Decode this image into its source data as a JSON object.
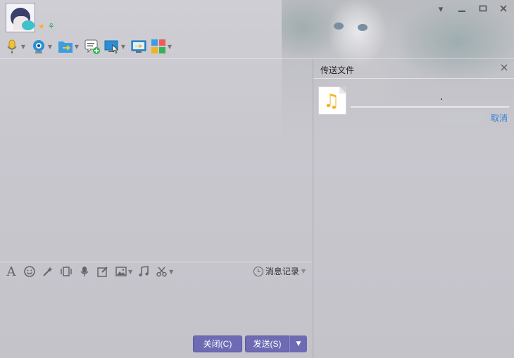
{
  "window": {
    "controls": {
      "dropdown_icon": "chevron-down-icon",
      "minimize_icon": "minimize-icon",
      "maximize_icon": "maximize-icon",
      "close_icon": "close-icon"
    }
  },
  "header": {
    "avatar_icon": "avatar-image",
    "status_icons": [
      "star-icon",
      "leaf-icon"
    ]
  },
  "toolbar": {
    "items": [
      {
        "icon": "microphone-icon",
        "has_dropdown": true
      },
      {
        "icon": "webcam-icon",
        "has_dropdown": true
      },
      {
        "icon": "send-file-folder-icon",
        "has_dropdown": true
      },
      {
        "icon": "new-chat-icon",
        "has_dropdown": false
      },
      {
        "icon": "remote-desktop-icon",
        "has_dropdown": true
      },
      {
        "icon": "screen-share-icon",
        "has_dropdown": false
      },
      {
        "icon": "apps-grid-icon",
        "has_dropdown": true
      }
    ]
  },
  "format_bar": {
    "icons": [
      "font-icon",
      "emoji-icon",
      "magic-icon",
      "shake-icon",
      "voice-icon",
      "edit-icon",
      "image-icon",
      "music-icon",
      "scissors-icon"
    ],
    "history_label": "消息记录"
  },
  "buttons": {
    "close_label": "关闭(C)",
    "send_label": "发送(S)"
  },
  "file_panel": {
    "title": "传送文件",
    "file_icon": "music-note-icon",
    "cancel_label": "取消"
  },
  "colors": {
    "button_bg": "#6e6bb4",
    "link": "#2f7fd8",
    "note": "#f2b31e"
  }
}
